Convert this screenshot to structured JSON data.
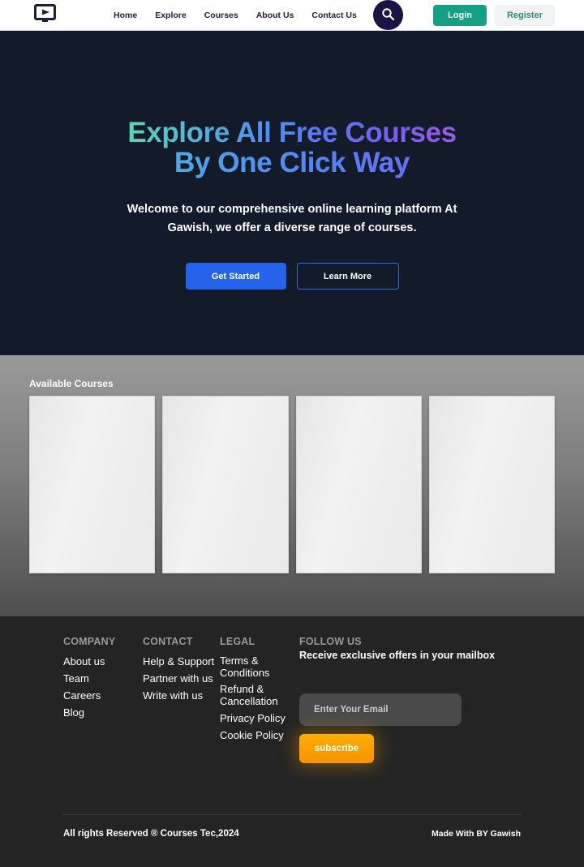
{
  "header": {
    "logo_icon": "monitor-play-icon",
    "nav": [
      {
        "label": "Home"
      },
      {
        "label": "Explore"
      },
      {
        "label": "Courses"
      },
      {
        "label": "About Us"
      },
      {
        "label": "Contact Us"
      }
    ],
    "search_icon": "search-icon",
    "login_label": "Login",
    "register_label": "Register",
    "colors": {
      "login_bg": "#14a085",
      "register_bg": "#f1f3f5",
      "register_text": "#2f8c7a",
      "search_bg": "#1b1245"
    }
  },
  "hero": {
    "title_line1": "Explore All Free Courses",
    "title_line2": "By One Click Way",
    "subtitle": "Welcome to our comprehensive online learning platform At Gawish, we offer a diverse range of courses.",
    "primary_button": "Get Started",
    "secondary_button": "Learn More",
    "colors": {
      "background": "#131a2a",
      "primary_button_bg": "#2563eb",
      "gradient_start": "#5fd6b4",
      "gradient_mid": "#4f8ff0",
      "gradient_end": "#9a5ae0"
    }
  },
  "courses": {
    "heading": "Available Courses",
    "cards": [
      {
        "placeholder": ""
      },
      {
        "placeholder": ""
      },
      {
        "placeholder": ""
      },
      {
        "placeholder": ""
      }
    ]
  },
  "footer": {
    "columns": [
      {
        "heading": "COMPANY",
        "links": [
          {
            "label": "About us"
          },
          {
            "label": "Team"
          },
          {
            "label": "Careers"
          },
          {
            "label": "Blog"
          }
        ]
      },
      {
        "heading": "CONTACT",
        "links": [
          {
            "label": "Help & Support"
          },
          {
            "label": "Partner with us"
          },
          {
            "label": "Write with us"
          }
        ]
      },
      {
        "heading": "LEGAL",
        "links": [
          {
            "label": "Terms & Conditions"
          },
          {
            "label": "Refund & Cancellation"
          },
          {
            "label": "Privacy Policy"
          },
          {
            "label": "Cookie Policy"
          }
        ]
      }
    ],
    "follow": {
      "heading": "FOLLOW US",
      "subheading": "Receive exclusive offers in your mailbox",
      "email_placeholder": "Enter Your Email",
      "email_value": "",
      "subscribe_label": "subscribe",
      "subscribe_color": "#ffae00"
    },
    "copyright": "All rights Reserved ® Courses Tec,2024",
    "made_by": "Made With BY Gawish"
  }
}
